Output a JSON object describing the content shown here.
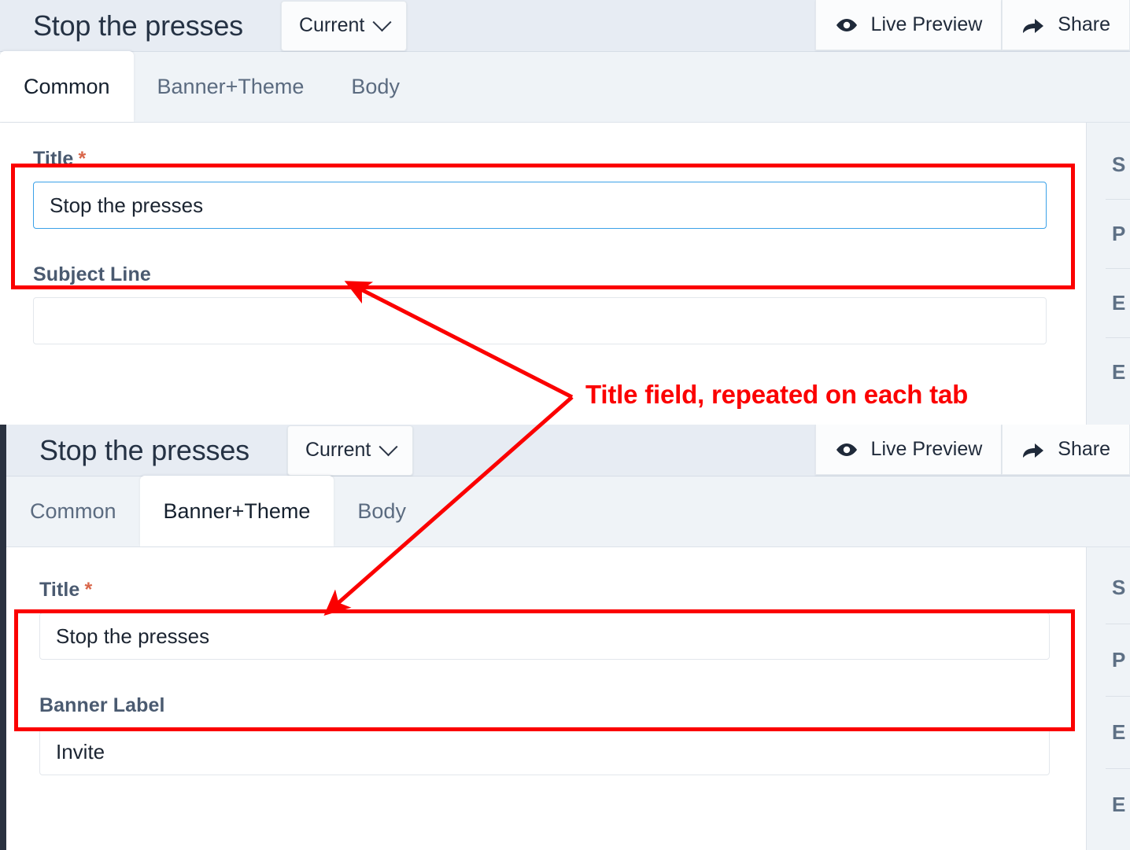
{
  "panels": [
    {
      "id": "panel-common",
      "header": {
        "title": "Stop the presses",
        "version_chip": {
          "label": "Current",
          "icon": "chevron-down-icon"
        },
        "actions": [
          {
            "label": "Live Preview",
            "icon": "eye-icon"
          },
          {
            "label": "Share",
            "icon": "share-arrow-icon"
          }
        ]
      },
      "tabs": [
        {
          "label": "Common",
          "active": true
        },
        {
          "label": "Banner+Theme",
          "active": false
        },
        {
          "label": "Body",
          "active": false
        }
      ],
      "fields": [
        {
          "label": "Title",
          "required": true,
          "required_mark": "*",
          "value": "Stop the presses",
          "placeholder": "",
          "focused": true
        },
        {
          "label": "Subject Line",
          "required": false,
          "required_mark": "",
          "value": "",
          "placeholder": "",
          "focused": false
        }
      ],
      "sidebar_items": [
        "S",
        "P",
        "E",
        "E"
      ]
    },
    {
      "id": "panel-banner-theme",
      "header": {
        "title": "Stop the presses",
        "version_chip": {
          "label": "Current",
          "icon": "chevron-down-icon"
        },
        "actions": [
          {
            "label": "Live Preview",
            "icon": "eye-icon"
          },
          {
            "label": "Share",
            "icon": "share-arrow-icon"
          }
        ]
      },
      "tabs": [
        {
          "label": "Common",
          "active": false
        },
        {
          "label": "Banner+Theme",
          "active": true
        },
        {
          "label": "Body",
          "active": false
        }
      ],
      "fields": [
        {
          "label": "Title",
          "required": true,
          "required_mark": "*",
          "value": "Stop the presses",
          "placeholder": "",
          "focused": false
        },
        {
          "label": "Banner Label",
          "required": false,
          "required_mark": "",
          "value": "Invite",
          "placeholder": "",
          "focused": false
        }
      ],
      "sidebar_items": [
        "S",
        "P",
        "E",
        "E"
      ]
    }
  ],
  "annotation": {
    "text": "Title field, repeated on each tab",
    "color": "#fb0000"
  },
  "colors": {
    "annotation_red": "#fb0000",
    "header_bg": "#e7ecf3",
    "tabstrip_bg": "#eff3f7",
    "focus_blue": "#3ba1e8",
    "required_orange": "#d9664a",
    "label_slate": "#4a5a70",
    "dark_edge": "#2a3240"
  }
}
